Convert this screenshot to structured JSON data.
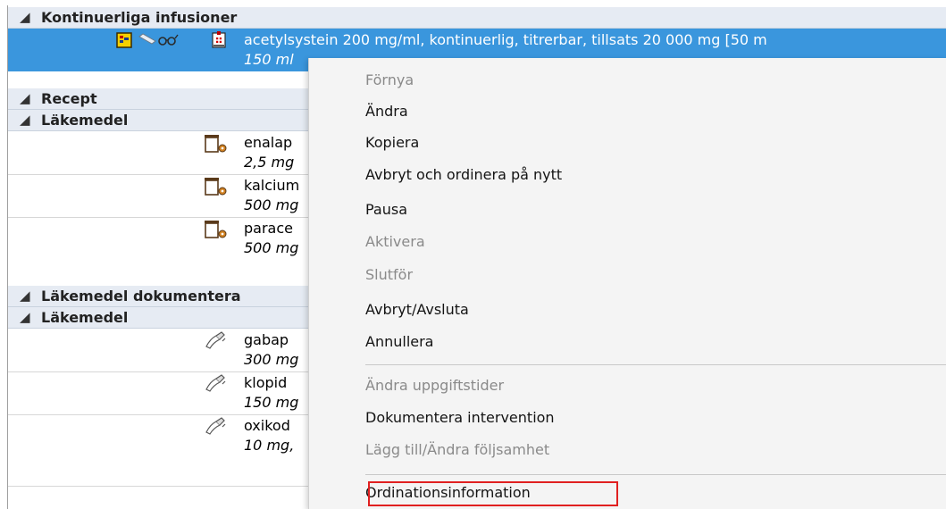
{
  "groups": {
    "continuous": "Kontinuerliga infusioner",
    "recept": "Recept",
    "drugs": "Läkemedel",
    "documented": "Läkemedel dokumentera",
    "drugs2": "Läkemedel"
  },
  "icons": {
    "triangle": "◢",
    "group_toggle": "collapse-triangle-icon",
    "continuous_row": [
      "infusion-schedule-icon",
      "syringe-icon",
      "glasses-icon",
      "pump-icon"
    ],
    "drug_row": "pill-container-icon",
    "documented_row": "handwritten-note-icon"
  },
  "rows": {
    "acetyl": {
      "line1": "acetylsystein 200 mg/ml, kontinuerlig, titrerbar, tillsats 20 000 mg [50 m",
      "line2": "150 ml"
    },
    "enalap": {
      "line1": "enalap",
      "line2": "2,5 mg"
    },
    "kalcium": {
      "line1": "kalcium",
      "line2": "500 mg"
    },
    "parace": {
      "line1": "parace",
      "line2": "500 mg"
    },
    "gabap": {
      "line1": "gabap",
      "line2": "300 mg"
    },
    "klopid": {
      "line1": "klopid",
      "line2": "150 mg"
    },
    "oxikod": {
      "line1": "oxikod",
      "line2": "10 mg,"
    }
  },
  "menu": {
    "fornya": "Förnya",
    "andra": "Ändra",
    "kopiera": "Kopiera",
    "avbryt_ordinera": "Avbryt och ordinera på nytt",
    "pausa": "Pausa",
    "aktivera": "Aktivera",
    "slutfor": "Slutför",
    "avbryt_avsluta": "Avbryt/Avsluta",
    "annullera": "Annullera",
    "andra_uppgiftstider": "Ändra uppgiftstider",
    "dokumentera_intervention": "Dokumentera intervention",
    "lagg_till": "Lägg till/Ändra följsamhet",
    "ordinationsinformation": "Ordinationsinformation"
  },
  "colors": {
    "selection": "#3a96dd",
    "group_header": "#e6ebf3",
    "menu_background": "#f4f4f4",
    "highlight_border": "#e02020",
    "disabled_text": "#8a8a8a"
  }
}
